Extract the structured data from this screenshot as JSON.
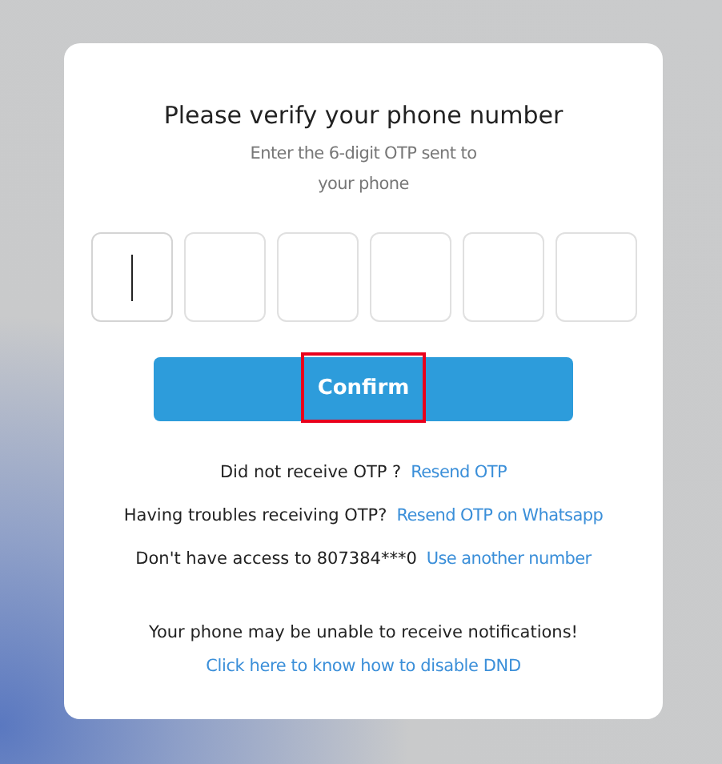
{
  "title": "Please verify your phone number",
  "subtitle_lines": [
    "Enter the 6-digit OTP sent to",
    "your phone"
  ],
  "otp_fields": [
    {
      "focused": true
    },
    {
      "focused": false
    },
    {
      "focused": false
    },
    {
      "focused": false
    },
    {
      "focused": false
    },
    {
      "focused": false
    }
  ],
  "confirm_button": {
    "label": "Confirm",
    "highlighted": true
  },
  "help_rows": [
    {
      "text": "Did not receive OTP ?",
      "link": "Resend OTP"
    },
    {
      "text": "Having troubles receiving OTP?",
      "link": "Resend OTP on Whatsapp"
    },
    {
      "text": "Don't have access to 807384***0",
      "link": "Use another number"
    }
  ],
  "notice": {
    "text": "Your phone may be unable to receive notifications!",
    "link": "Click here to know how to disable DND"
  }
}
